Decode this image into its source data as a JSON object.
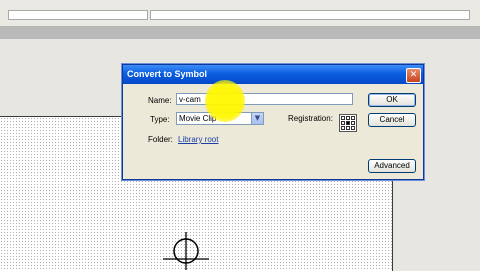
{
  "dialog": {
    "title": "Convert to Symbol",
    "name_label": "Name:",
    "name_value": "v-cam",
    "type_label": "Type:",
    "type_value": "Movie Clip",
    "registration_label": "Registration:",
    "folder_label": "Folder:",
    "folder_value": "Library root",
    "ok_label": "OK",
    "cancel_label": "Cancel",
    "advanced_label": "Advanced"
  },
  "icons": {
    "close": "close-icon",
    "dropdown": "chevron-down-icon",
    "registration": "registration-grid-icon",
    "stage_mark": "crosshair-icon"
  },
  "colors": {
    "titlebar": "#0a5fe0",
    "highlight": "#fff200",
    "dialog_bg": "#ece9d8"
  }
}
